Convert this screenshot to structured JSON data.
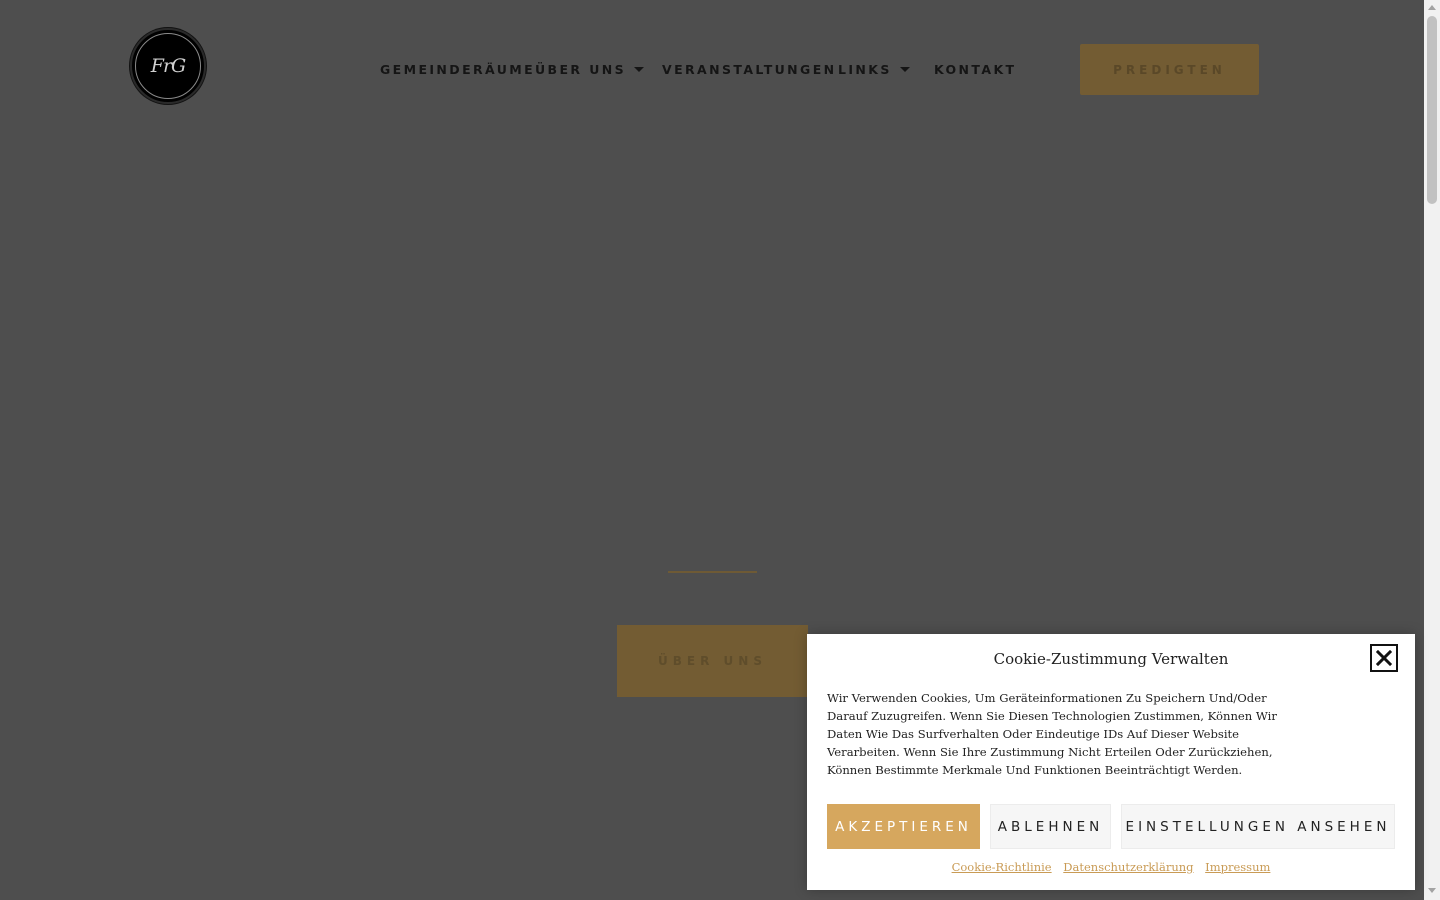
{
  "logo": {
    "text": "FrG"
  },
  "nav": {
    "items": [
      {
        "label": "GEMEINDERÄUME",
        "dropdown": false
      },
      {
        "label": "ÜBER UNS",
        "dropdown": true
      },
      {
        "label": "VERANSTALTUNGEN",
        "dropdown": false
      },
      {
        "label": "LINKS",
        "dropdown": true
      },
      {
        "label": "KONTAKT",
        "dropdown": false
      }
    ],
    "cta_label": "PREDIGTEN"
  },
  "hero": {
    "button_label": "ÜBER UNS"
  },
  "cookie": {
    "title": "Cookie-Zustimmung Verwalten",
    "text": "Wir Verwenden Cookies, Um Geräteinformationen Zu Speichern Und/Oder Darauf Zuzugreifen. Wenn Sie Diesen Technologien Zustimmen, Können Wir Daten Wie Das Surfverhalten Oder Eindeutige IDs Auf Dieser Website Verarbeiten. Wenn Sie Ihre Zustimmung Nicht Erteilen Oder Zurückziehen, Können Bestimmte Merkmale Und Funktionen Beeinträchtigt Werden.",
    "accept_label": "AKZEPTIEREN",
    "deny_label": "ABLEHNEN",
    "settings_label": "EINSTELLUNGEN ANSEHEN",
    "links": [
      "Cookie-Richtlinie",
      "Datenschutzerklärung",
      "Impressum"
    ]
  },
  "colors": {
    "overlay_bg": "#4e4e4e",
    "accent": "#d6a75e",
    "accent_dimmed": "#735c33",
    "panel_bg": "#ffffff"
  }
}
